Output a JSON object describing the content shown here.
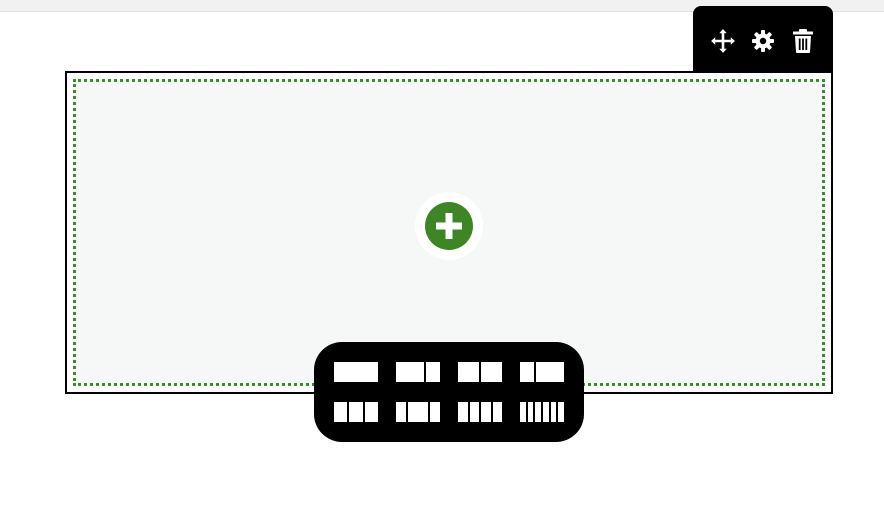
{
  "toolbar": {
    "buttons": [
      {
        "icon": "move-icon"
      },
      {
        "icon": "gear-icon"
      },
      {
        "icon": "trash-icon"
      }
    ]
  },
  "section": {
    "add_button_icon": "plus-icon",
    "accent_color": "#3d8525",
    "border_color": "#000000"
  },
  "layout_options": [
    {
      "name": "layout-1-column",
      "columns": [
        1
      ]
    },
    {
      "name": "layout-2-3-1-3",
      "columns": [
        2,
        1
      ]
    },
    {
      "name": "layout-1-2-1-2",
      "columns": [
        1,
        1
      ]
    },
    {
      "name": "layout-1-3-2-3",
      "columns": [
        1,
        2
      ]
    },
    {
      "name": "layout-3-columns",
      "columns": [
        1,
        1,
        1
      ]
    },
    {
      "name": "layout-1-2-1",
      "columns": [
        1,
        2,
        1
      ]
    },
    {
      "name": "layout-4-columns",
      "columns": [
        1,
        1,
        1,
        1
      ]
    },
    {
      "name": "layout-6-columns",
      "columns": [
        1,
        1,
        1,
        1,
        1,
        1
      ]
    }
  ]
}
